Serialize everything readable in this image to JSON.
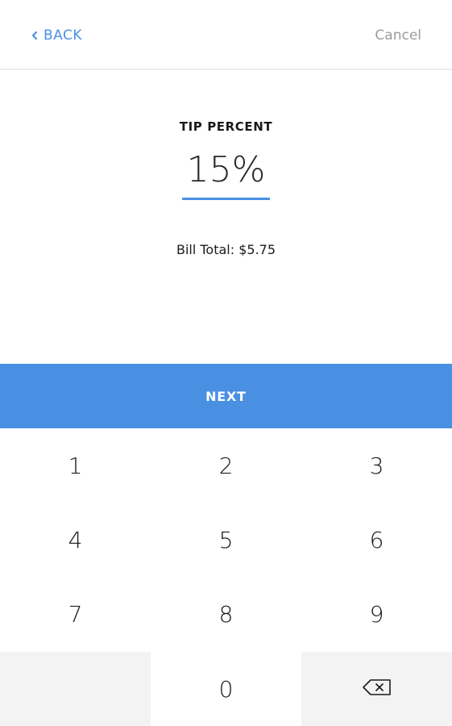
{
  "header": {
    "back_label": "BACK",
    "cancel_label": "Cancel"
  },
  "tip": {
    "title": "TIP PERCENT",
    "value": "15%",
    "bill_total": "Bill Total: $5.75"
  },
  "next_label": "NEXT",
  "keypad": {
    "keys": [
      "1",
      "2",
      "3",
      "4",
      "5",
      "6",
      "7",
      "8",
      "9",
      "0"
    ]
  },
  "colors": {
    "accent": "#4a90e2",
    "muted": "#9b9b9b",
    "key_gray": "#f3f3f3"
  },
  "icons": {
    "back": "chevron-left-icon",
    "delete": "backspace-icon"
  }
}
